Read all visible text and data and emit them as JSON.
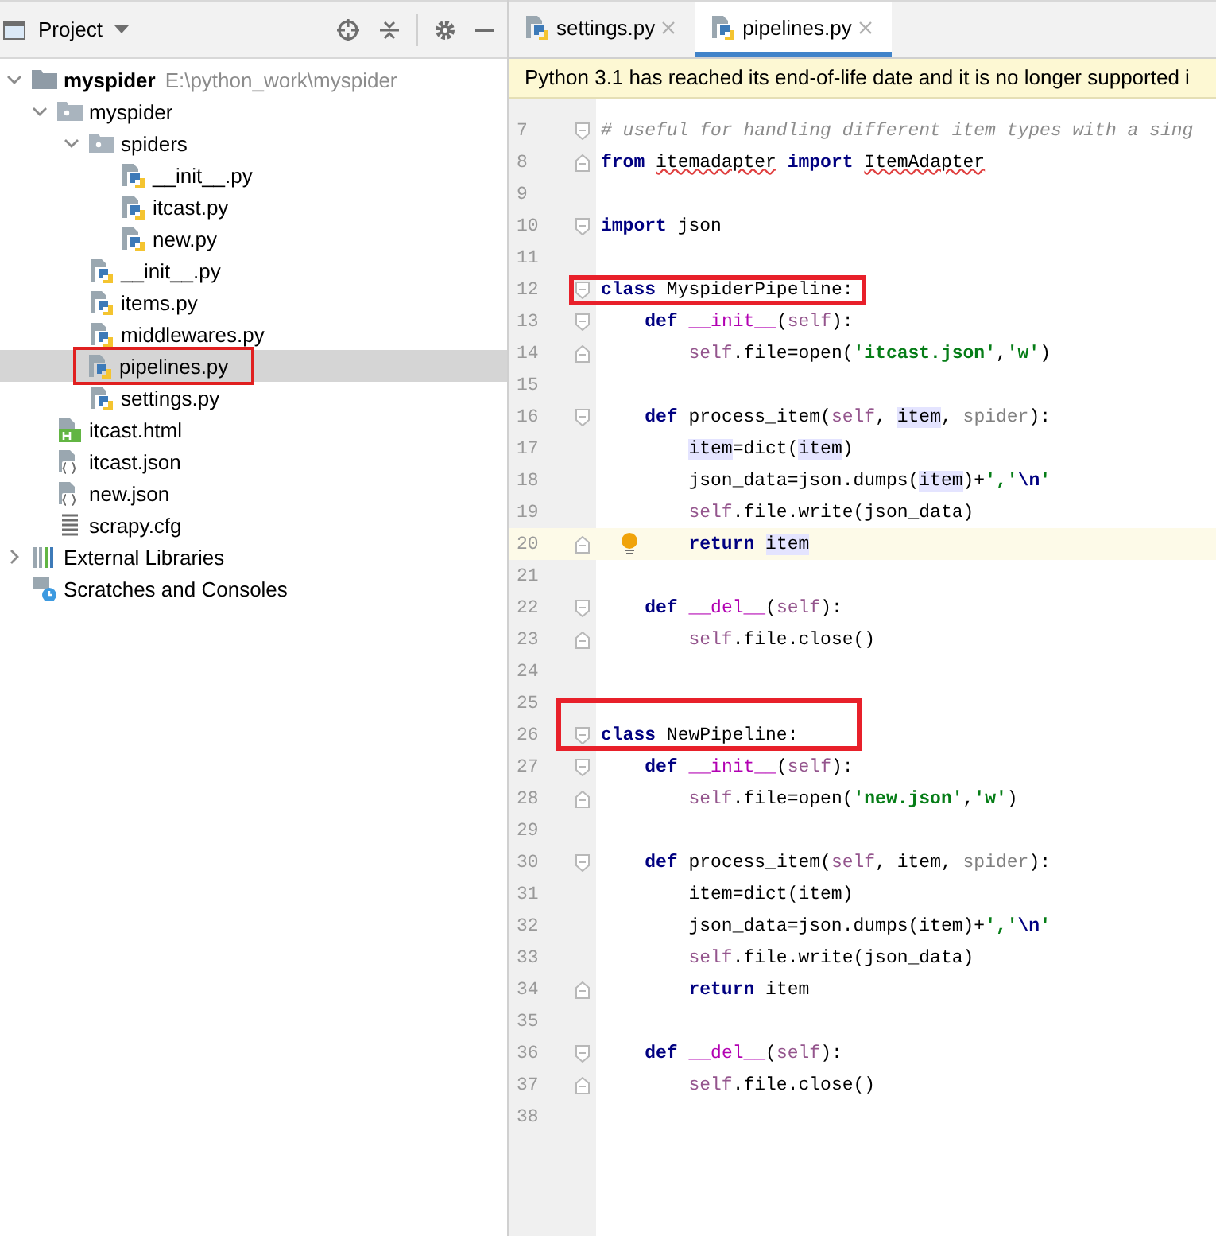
{
  "project_panel": {
    "title": "Project",
    "tree": [
      {
        "label": "myspider",
        "path": "E:\\python_work\\myspider",
        "kind": "root",
        "expanded": true,
        "selected": false,
        "boxed": false,
        "children": [
          {
            "label": "myspider",
            "kind": "package",
            "expanded": true,
            "selected": false,
            "boxed": false,
            "children": [
              {
                "label": "spiders",
                "kind": "package",
                "expanded": true,
                "selected": false,
                "boxed": false,
                "children": [
                  {
                    "label": "__init__.py",
                    "kind": "python",
                    "selected": false,
                    "boxed": false
                  },
                  {
                    "label": "itcast.py",
                    "kind": "python",
                    "selected": false,
                    "boxed": false
                  },
                  {
                    "label": "new.py",
                    "kind": "python",
                    "selected": false,
                    "boxed": false
                  }
                ]
              },
              {
                "label": "__init__.py",
                "kind": "python",
                "selected": false,
                "boxed": false
              },
              {
                "label": "items.py",
                "kind": "python",
                "selected": false,
                "boxed": false
              },
              {
                "label": "middlewares.py",
                "kind": "python",
                "selected": false,
                "boxed": false
              },
              {
                "label": "pipelines.py",
                "kind": "python",
                "selected": true,
                "boxed": true
              },
              {
                "label": "settings.py",
                "kind": "python",
                "selected": false,
                "boxed": false
              }
            ]
          },
          {
            "label": "itcast.html",
            "kind": "html",
            "selected": false,
            "boxed": false
          },
          {
            "label": "itcast.json",
            "kind": "json",
            "selected": false,
            "boxed": false
          },
          {
            "label": "new.json",
            "kind": "json",
            "selected": false,
            "boxed": false
          },
          {
            "label": "scrapy.cfg",
            "kind": "cfg",
            "selected": false,
            "boxed": false
          }
        ]
      },
      {
        "label": "External Libraries",
        "kind": "libraries",
        "expanded": false,
        "selected": false,
        "boxed": false
      },
      {
        "label": "Scratches and Consoles",
        "kind": "scratches",
        "selected": false,
        "boxed": false
      }
    ]
  },
  "editor": {
    "tabs": [
      {
        "label": "settings.py",
        "selected": false
      },
      {
        "label": "pipelines.py",
        "selected": true
      }
    ],
    "banner": "Python 3.1 has reached its end-of-life date and it is no longer supported i",
    "lines": [
      {
        "number": "7",
        "fold_start": true,
        "current": false,
        "boxed": false,
        "bulb": false,
        "tokens": [
          {
            "kind": "comment",
            "text": "# useful for handling different item types with a sing"
          }
        ]
      },
      {
        "number": "8",
        "fold_end": true,
        "current": false,
        "boxed": false,
        "bulb": false,
        "tokens": [
          {
            "kind": "keyword",
            "text": "from"
          },
          {
            "kind": "error",
            "text": " itemadapter"
          },
          {
            "kind": "keyword",
            "text": " import"
          },
          {
            "kind": "error",
            "text": " ItemAdapter"
          }
        ]
      },
      {
        "number": "9",
        "current": false,
        "boxed": false,
        "bulb": false
      },
      {
        "number": "10",
        "fold_start": true,
        "current": false,
        "boxed": false,
        "bulb": false,
        "tokens": [
          {
            "kind": "keyword",
            "text": "import"
          },
          {
            "kind": "plain",
            "text": " json"
          }
        ]
      },
      {
        "number": "11",
        "current": false,
        "boxed": false,
        "bulb": false
      },
      {
        "number": "12",
        "fold_start": true,
        "current": false,
        "boxed": true,
        "bulb": false,
        "tokens": [
          {
            "kind": "keyword",
            "text": "class"
          },
          {
            "kind": "plain",
            "text": " MyspiderPipeline:"
          }
        ]
      },
      {
        "number": "13",
        "fold_start": true,
        "current": false,
        "boxed": false,
        "bulb": false,
        "tokens": [
          {
            "kind": "keyword",
            "text": "    def"
          },
          {
            "kind": "magic",
            "text": " __init__"
          },
          {
            "kind": "plain",
            "text": "("
          },
          {
            "kind": "self",
            "text": "self"
          },
          {
            "kind": "plain",
            "text": "):"
          }
        ]
      },
      {
        "number": "14",
        "fold_end": true,
        "current": false,
        "boxed": false,
        "bulb": false,
        "tokens": [
          {
            "kind": "self",
            "text": "        self"
          },
          {
            "kind": "plain",
            "text": ".file=open("
          },
          {
            "kind": "string",
            "text": "'itcast.json'"
          },
          {
            "kind": "plain",
            "text": ","
          },
          {
            "kind": "string",
            "text": "'w'"
          },
          {
            "kind": "plain",
            "text": ")"
          }
        ]
      },
      {
        "number": "15",
        "current": false,
        "boxed": false,
        "bulb": false
      },
      {
        "number": "16",
        "fold_start": true,
        "current": false,
        "boxed": false,
        "bulb": false,
        "tokens": [
          {
            "kind": "keyword",
            "text": "    def"
          },
          {
            "kind": "plain",
            "text": " process_item("
          },
          {
            "kind": "self",
            "text": "self"
          },
          {
            "kind": "plain",
            "text": ","
          },
          {
            "kind": "ref",
            "text": " item"
          },
          {
            "kind": "plain",
            "text": ","
          },
          {
            "kind": "unused",
            "text": " spider"
          },
          {
            "kind": "plain",
            "text": "):"
          }
        ]
      },
      {
        "number": "17",
        "current": false,
        "boxed": false,
        "bulb": false,
        "tokens": [
          {
            "kind": "ref",
            "text": "        item"
          },
          {
            "kind": "plain",
            "text": "=dict("
          },
          {
            "kind": "ref",
            "text": "item"
          },
          {
            "kind": "plain",
            "text": ")"
          }
        ]
      },
      {
        "number": "18",
        "current": false,
        "boxed": false,
        "bulb": false,
        "tokens": [
          {
            "kind": "plain",
            "text": "        json_data=json.dumps("
          },
          {
            "kind": "ref",
            "text": "item"
          },
          {
            "kind": "plain",
            "text": ")+"
          },
          {
            "kind": "string",
            "text": "','"
          },
          {
            "kind": "escape",
            "text": "\\n"
          },
          {
            "kind": "string",
            "text": "'"
          }
        ]
      },
      {
        "number": "19",
        "current": false,
        "boxed": false,
        "bulb": false,
        "tokens": [
          {
            "kind": "self",
            "text": "        self"
          },
          {
            "kind": "plain",
            "text": ".file.write(json_data)"
          }
        ]
      },
      {
        "number": "20",
        "fold_end": true,
        "current": true,
        "boxed": false,
        "bulb": true,
        "tokens": [
          {
            "kind": "keyword",
            "text": "        return"
          },
          {
            "kind": "ref",
            "text": " item"
          }
        ]
      },
      {
        "number": "21",
        "current": false,
        "boxed": false,
        "bulb": false
      },
      {
        "number": "22",
        "fold_start": true,
        "current": false,
        "boxed": false,
        "bulb": false,
        "tokens": [
          {
            "kind": "keyword",
            "text": "    def"
          },
          {
            "kind": "magic",
            "text": " __del__"
          },
          {
            "kind": "plain",
            "text": "("
          },
          {
            "kind": "self",
            "text": "self"
          },
          {
            "kind": "plain",
            "text": "):"
          }
        ]
      },
      {
        "number": "23",
        "fold_end": true,
        "current": false,
        "boxed": false,
        "bulb": false,
        "tokens": [
          {
            "kind": "self",
            "text": "        self"
          },
          {
            "kind": "plain",
            "text": ".file.close()"
          }
        ]
      },
      {
        "number": "24",
        "current": false,
        "boxed": false,
        "bulb": false
      },
      {
        "number": "25",
        "current": false,
        "boxed": true,
        "bulb": false
      },
      {
        "number": "26",
        "fold_start": true,
        "current": false,
        "boxed": true,
        "bulb": false,
        "tokens": [
          {
            "kind": "keyword",
            "text": "class"
          },
          {
            "kind": "plain",
            "text": " NewPipeline:"
          }
        ]
      },
      {
        "number": "27",
        "fold_start": true,
        "current": false,
        "boxed": false,
        "bulb": false,
        "tokens": [
          {
            "kind": "keyword",
            "text": "    def"
          },
          {
            "kind": "magic",
            "text": " __init__"
          },
          {
            "kind": "plain",
            "text": "("
          },
          {
            "kind": "self",
            "text": "self"
          },
          {
            "kind": "plain",
            "text": "):"
          }
        ]
      },
      {
        "number": "28",
        "fold_end": true,
        "current": false,
        "boxed": false,
        "bulb": false,
        "tokens": [
          {
            "kind": "self",
            "text": "        self"
          },
          {
            "kind": "plain",
            "text": ".file=open("
          },
          {
            "kind": "string",
            "text": "'new.json'"
          },
          {
            "kind": "plain",
            "text": ","
          },
          {
            "kind": "string",
            "text": "'w'"
          },
          {
            "kind": "plain",
            "text": ")"
          }
        ]
      },
      {
        "number": "29",
        "current": false,
        "boxed": false,
        "bulb": false
      },
      {
        "number": "30",
        "fold_start": true,
        "current": false,
        "boxed": false,
        "bulb": false,
        "tokens": [
          {
            "kind": "keyword",
            "text": "    def"
          },
          {
            "kind": "plain",
            "text": " process_item("
          },
          {
            "kind": "self",
            "text": "self"
          },
          {
            "kind": "plain",
            "text": ", item,"
          },
          {
            "kind": "unused",
            "text": " spider"
          },
          {
            "kind": "plain",
            "text": "):"
          }
        ]
      },
      {
        "number": "31",
        "current": false,
        "boxed": false,
        "bulb": false,
        "tokens": [
          {
            "kind": "plain",
            "text": "        item=dict(item)"
          }
        ]
      },
      {
        "number": "32",
        "current": false,
        "boxed": false,
        "bulb": false,
        "tokens": [
          {
            "kind": "plain",
            "text": "        json_data=json.dumps(item)+"
          },
          {
            "kind": "string",
            "text": "','"
          },
          {
            "kind": "escape",
            "text": "\\n"
          },
          {
            "kind": "string",
            "text": "'"
          }
        ]
      },
      {
        "number": "33",
        "current": false,
        "boxed": false,
        "bulb": false,
        "tokens": [
          {
            "kind": "self",
            "text": "        self"
          },
          {
            "kind": "plain",
            "text": ".file.write(json_data)"
          }
        ]
      },
      {
        "number": "34",
        "fold_end": true,
        "current": false,
        "boxed": false,
        "bulb": false,
        "tokens": [
          {
            "kind": "keyword",
            "text": "        return"
          },
          {
            "kind": "plain",
            "text": " item"
          }
        ]
      },
      {
        "number": "35",
        "current": false,
        "boxed": false,
        "bulb": false
      },
      {
        "number": "36",
        "fold_start": true,
        "current": false,
        "boxed": false,
        "bulb": false,
        "tokens": [
          {
            "kind": "keyword",
            "text": "    def"
          },
          {
            "kind": "magic",
            "text": " __del__"
          },
          {
            "kind": "plain",
            "text": "("
          },
          {
            "kind": "self",
            "text": "self"
          },
          {
            "kind": "plain",
            "text": "):"
          }
        ]
      },
      {
        "number": "37",
        "fold_end": true,
        "current": false,
        "boxed": false,
        "bulb": false,
        "tokens": [
          {
            "kind": "self",
            "text": "        self"
          },
          {
            "kind": "plain",
            "text": ".file.close()"
          }
        ]
      },
      {
        "number": "38",
        "current": false,
        "boxed": false,
        "bulb": false
      }
    ]
  }
}
